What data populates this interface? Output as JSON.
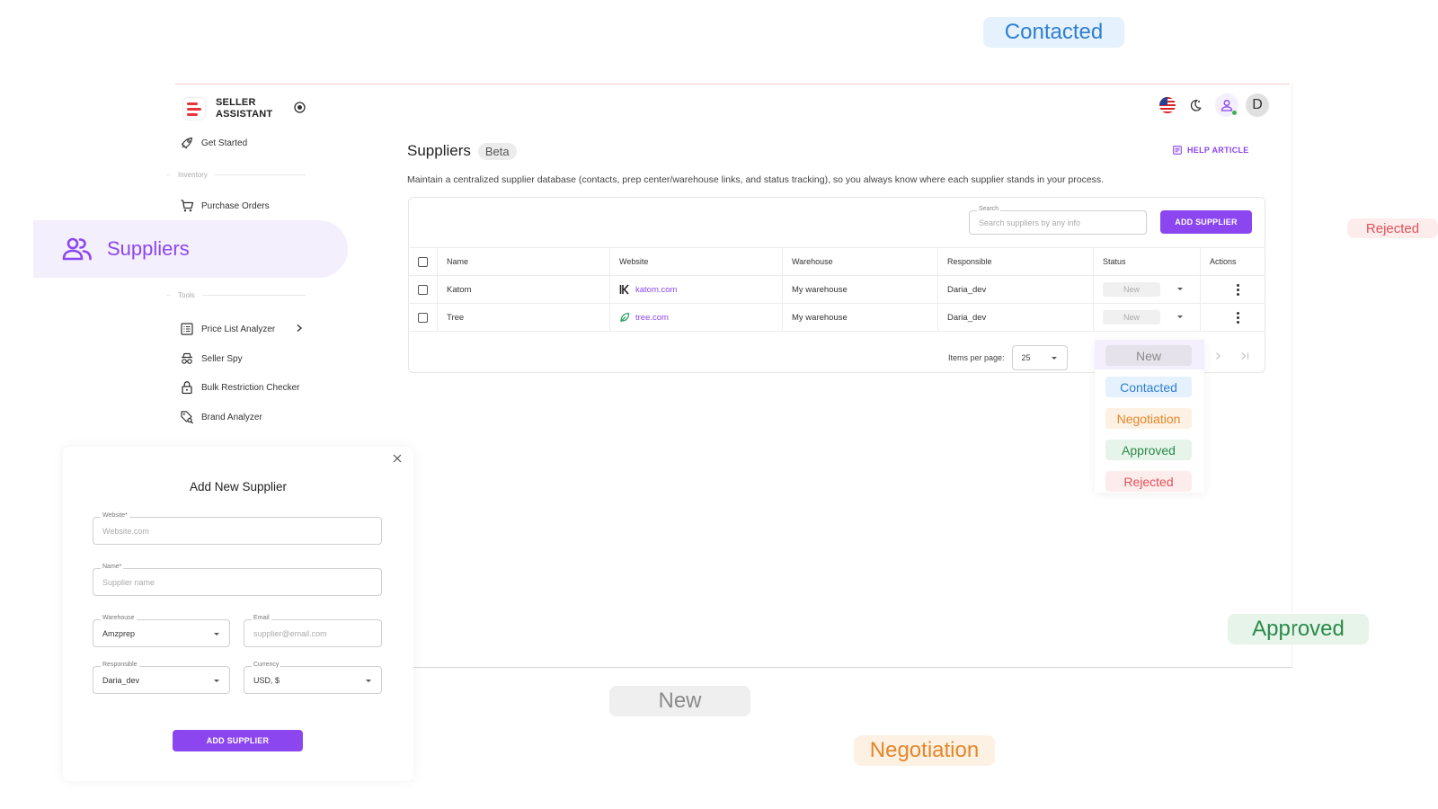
{
  "brand": {
    "line1": "SELLER",
    "line2": "ASSISTANT",
    "accent": "#8b46f0",
    "logo_color": "#e8333c"
  },
  "nav": {
    "get_started": "Get Started",
    "section_inventory": "Inventory",
    "purchase_orders": "Purchase Orders",
    "suppliers": "Suppliers",
    "section_tools": "Tools",
    "price_list_analyzer": "Price List Analyzer",
    "seller_spy": "Seller Spy",
    "bulk_restriction_checker": "Bulk Restriction Checker",
    "brand_analyzer": "Brand Analyzer"
  },
  "topbar": {
    "avatar_letter": "D"
  },
  "page": {
    "title": "Suppliers",
    "badge": "Beta",
    "help_link": "HELP ARTICLE",
    "description": "Maintain a centralized supplier database (contacts, prep center/warehouse links, and status tracking), so you always know where each supplier stands in your process."
  },
  "search": {
    "label": "Search",
    "placeholder": "Search suppliers by any info"
  },
  "add_supplier_button": "ADD SUPPLIER",
  "table": {
    "columns": [
      "Name",
      "Website",
      "Warehouse",
      "Responsible",
      "Status",
      "Actions"
    ],
    "rows": [
      {
        "name": "Katom",
        "website": "katom.com",
        "warehouse": "My warehouse",
        "responsible": "Daria_dev",
        "status": "New"
      },
      {
        "name": "Tree",
        "website": "tree.com",
        "warehouse": "My warehouse",
        "responsible": "Daria_dev",
        "status": "New"
      }
    ]
  },
  "pager": {
    "label": "Items per page:",
    "value": "25"
  },
  "status_dropdown": {
    "options": [
      "New",
      "Contacted",
      "Negotiation",
      "Approved",
      "Rejected"
    ],
    "selected": "New"
  },
  "floating_statuses": {
    "contacted": "Contacted",
    "rejected": "Rejected",
    "approved": "Approved",
    "new": "New",
    "negotiation": "Negotiation"
  },
  "status_colors": {
    "new": "#8a8a8a",
    "contacted": "#2f7fd1",
    "negotiation": "#e4862a",
    "approved": "#2b8a4a",
    "rejected": "#e0525a"
  },
  "modal": {
    "title": "Add New Supplier",
    "website": {
      "label": "Website*",
      "placeholder": "Website.com"
    },
    "name": {
      "label": "Name*",
      "placeholder": "Supplier name"
    },
    "warehouse": {
      "label": "Warehouse",
      "value": "Amzprep"
    },
    "email": {
      "label": "Email",
      "placeholder": "supplier@email.com"
    },
    "responsible": {
      "label": "Responsible",
      "value": "Daria_dev"
    },
    "currency": {
      "label": "Currency",
      "value": "USD, $"
    },
    "submit": "ADD SUPPLIER"
  }
}
